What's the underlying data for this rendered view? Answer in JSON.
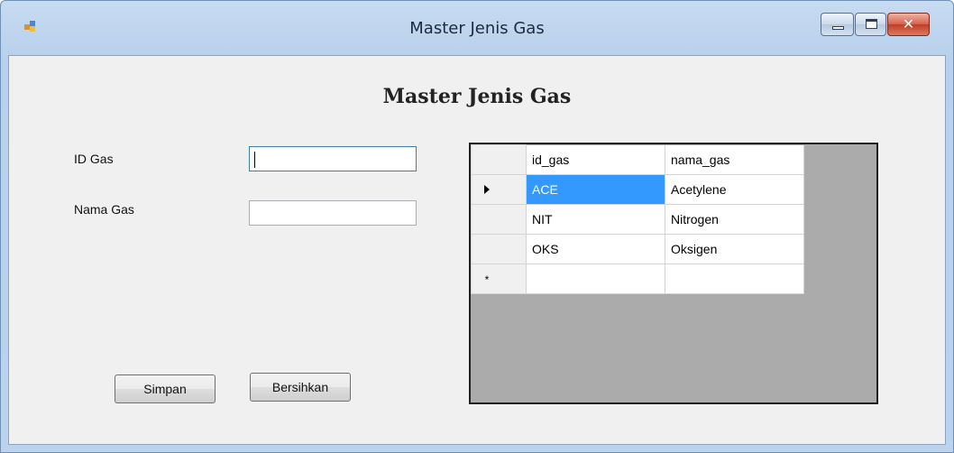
{
  "window": {
    "title": "Master Jenis Gas",
    "close_glyph": "✕"
  },
  "form": {
    "heading": "Master Jenis Gas",
    "id_label": "ID Gas",
    "id_value": "",
    "nama_label": "Nama Gas",
    "nama_value": ""
  },
  "buttons": {
    "simpan": "Simpan",
    "bersihkan": "Bersihkan"
  },
  "grid": {
    "columns": [
      "id_gas",
      "nama_gas"
    ],
    "rows": [
      {
        "id_gas": "ACE",
        "nama_gas": "Acetylene"
      },
      {
        "id_gas": "NIT",
        "nama_gas": "Nitrogen"
      },
      {
        "id_gas": "OKS",
        "nama_gas": "Oksigen"
      }
    ],
    "new_row_marker": "*",
    "selected_color": "#3399ff"
  },
  "icons": {
    "app": "windows-form-icon",
    "current_row": "row-pointer-icon"
  }
}
